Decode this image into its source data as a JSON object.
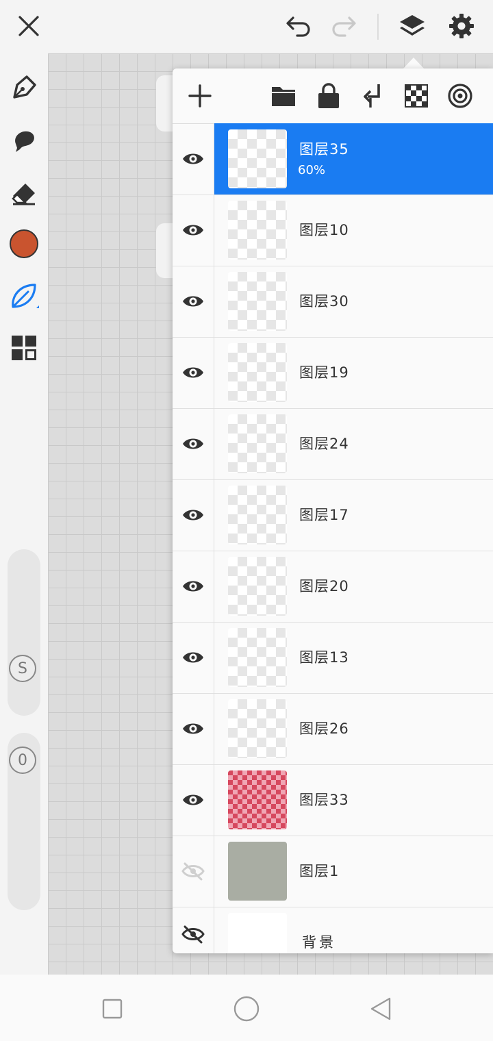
{
  "top_bar": {
    "close_icon": "close-icon",
    "undo_icon": "undo-icon",
    "redo_icon": "redo-icon",
    "layers_icon": "layers-icon",
    "settings_icon": "gear-icon"
  },
  "left_toolbar": {
    "tools": [
      "pen-icon",
      "smudge-icon",
      "eraser-icon",
      "color-swatch",
      "leaf-brush-icon",
      "gallery-grid-icon"
    ],
    "current_color": "#c9542f",
    "size_slider_label": "S",
    "opacity_slider_label": "0"
  },
  "layers_panel": {
    "toolbar": [
      "add-icon",
      "folder-icon",
      "lock-icon",
      "merge-down-icon",
      "transparency-icon",
      "blend-icon"
    ],
    "layers": [
      {
        "name": "图层35",
        "opacity": "60%",
        "visible": true,
        "selected": true
      },
      {
        "name": "图层10",
        "visible": true
      },
      {
        "name": "图层30",
        "visible": true
      },
      {
        "name": "图层19",
        "visible": true
      },
      {
        "name": "图层24",
        "visible": true
      },
      {
        "name": "图层17",
        "visible": true
      },
      {
        "name": "图层20",
        "visible": true
      },
      {
        "name": "图层13",
        "visible": true
      },
      {
        "name": "图层26",
        "visible": true
      },
      {
        "name": "图层33",
        "visible": true
      },
      {
        "name": "图层1",
        "visible": false
      },
      {
        "name": "背景",
        "visible": false
      }
    ],
    "selected_color": "#1a7cf2"
  },
  "nav_bar": {
    "items": [
      "recents-square-icon",
      "home-circle-icon",
      "back-triangle-icon"
    ]
  }
}
